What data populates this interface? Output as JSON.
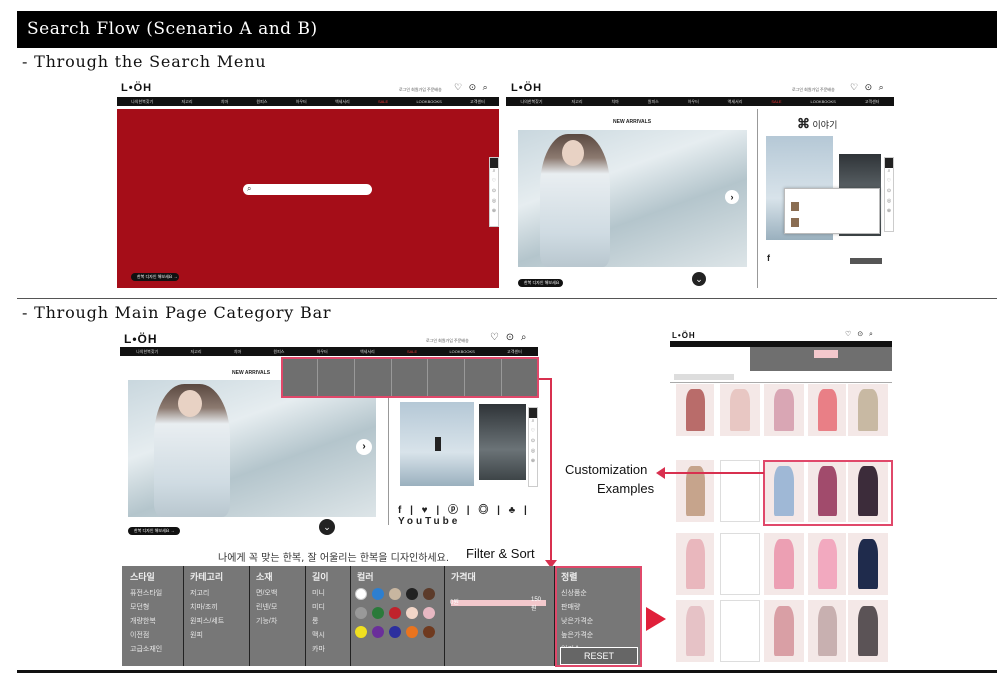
{
  "header": {
    "title": "Search Flow (Scenario A and B)"
  },
  "sections": {
    "search_menu": "- Through the Search Menu",
    "category_bar": "- Through Main Page Category Bar"
  },
  "site": {
    "logo": "L•ÖH",
    "toplinks": [
      "로그인",
      "회원가입",
      "주문배송"
    ],
    "icons": "♡ ⊙ ⌕",
    "nav": [
      "나의한복찾기",
      "저고리",
      "치마",
      "원피스",
      "아우터",
      "액세서리",
      "SALE",
      "LOOKBOOKS",
      "고객센터"
    ],
    "new_arrivals": "NEW ARRIVALS",
    "story_title": "이야기",
    "pill_text": "한복 디자인 해보세요 →",
    "slogan": "나에게 꼭 맞는 한복, 잘 어울리는 한복을 디자인하세요.",
    "social": "f | ♥ | ⓟ | ◎ | ♣ | YouTube"
  },
  "annotations": {
    "filter_sort": "Filter & Sort",
    "customization": "Customization",
    "examples": "Examples"
  },
  "filter": {
    "columns": [
      {
        "head": "스타일",
        "items": [
          "퓨전스타일",
          "모던형",
          "개량한복",
          "이전점",
          "고급소재인"
        ]
      },
      {
        "head": "카테고리",
        "items": [
          "저고리",
          "치마/조끼",
          "원피스/세트",
          "원피"
        ]
      },
      {
        "head": "소재",
        "items": [
          "면/오백",
          "린넨/모",
          "기능/차"
        ]
      },
      {
        "head": "길이",
        "items": [
          "미니",
          "미디",
          "롱",
          "맥시",
          "카마"
        ]
      },
      {
        "head": "컬러",
        "items": []
      },
      {
        "head": "가격대",
        "items": []
      },
      {
        "head": "정렬",
        "items": [
          "신상품순",
          "판매량",
          "낮은가격순",
          "높은가격순",
          "인기순"
        ]
      }
    ],
    "colors": [
      "#ffffff",
      "#2d7fd0",
      "#c8b6a0",
      "#222222",
      "#5c3b2a",
      "#999999",
      "#2a7a3a",
      "#c0232c",
      "#f2d6c8",
      "#e7b8c2",
      "#f0e020",
      "#6a2f9a",
      "#2c2f9e",
      "#e9741f",
      "#6f3a1f"
    ],
    "price_min": "0원",
    "price_max": "150원",
    "reset": "RESET"
  }
}
